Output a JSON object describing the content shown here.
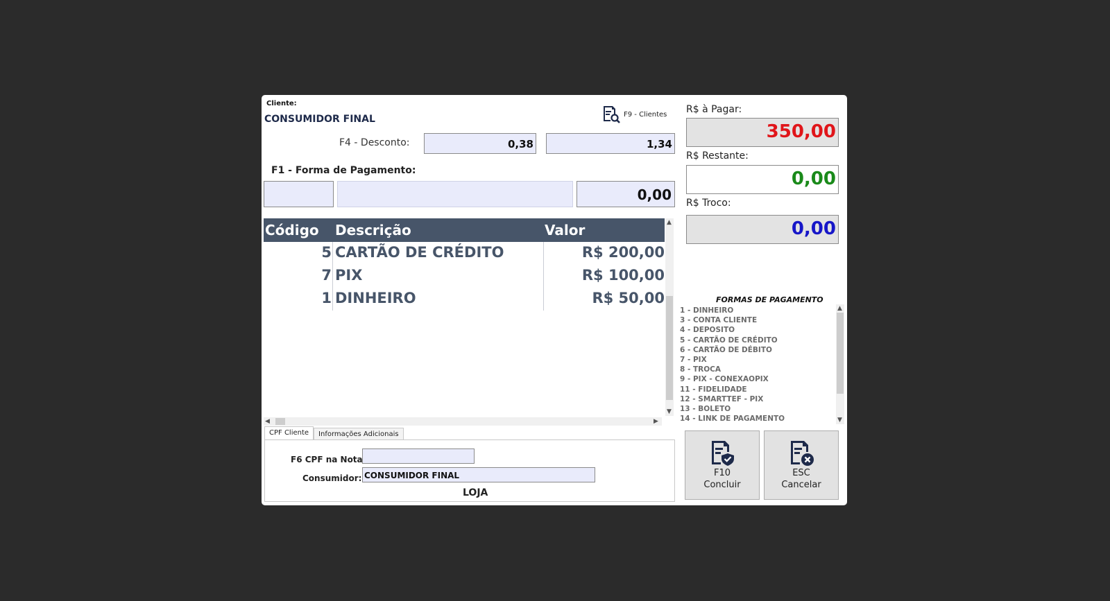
{
  "cliente": {
    "label": "Cliente:",
    "name": "CONSUMIDOR FINAL"
  },
  "f9_button": {
    "icon": "client-search-icon",
    "label": "F9 - Clientes"
  },
  "desconto": {
    "label": "F4 - Desconto:",
    "value1": "0,38",
    "value2": "1,34"
  },
  "forma_pagamento": {
    "label": "F1 - Forma de Pagamento:",
    "code": "",
    "description": "",
    "value": "0,00"
  },
  "grid": {
    "headers": {
      "code": "Código",
      "description": "Descrição",
      "value": "Valor"
    },
    "rows": [
      {
        "code": "5",
        "description": "CARTÃO DE CRÉDITO",
        "value": "R$ 200,00"
      },
      {
        "code": "7",
        "description": "PIX",
        "value": "R$ 100,00"
      },
      {
        "code": "1",
        "description": "DINHEIRO",
        "value": "R$ 50,00"
      }
    ]
  },
  "tabs": [
    {
      "label": "CPF Cliente",
      "active": true
    },
    {
      "label": "Informações Adicionais",
      "active": false
    }
  ],
  "cpf_panel": {
    "cpf_label": "F6 CPF na Nota:",
    "cpf_value": "",
    "consumidor_label": "Consumidor:",
    "consumidor_value": "CONSUMIDOR FINAL",
    "loja": "LOJA"
  },
  "totals": {
    "pagar_label": "R$ à Pagar:",
    "pagar_value": "350,00",
    "pagar_color": "#e0151a",
    "restante_label": "R$ Restante:",
    "restante_value": "0,00",
    "restante_color": "#1a8a1a",
    "troco_label": "R$ Troco:",
    "troco_value": "0,00",
    "troco_color": "#1616c8"
  },
  "formas": {
    "title": "FORMAS DE PAGAMENTO",
    "items": [
      "1 - DINHEIRO",
      "3 - CONTA CLIENTE",
      "4 - DEPOSITO",
      "5 - CARTÃO DE CRÉDITO",
      "6 - CARTÃO DE DÉBITO",
      "7 - PIX",
      "8 - TROCA",
      "9 - PIX - CONEXAOPIX",
      "11 - FIDELIDADE",
      "12 - SMARTTEF - PIX",
      "13 - BOLETO",
      "14 - LINK DE PAGAMENTO"
    ]
  },
  "actions": {
    "concluir": {
      "key": "F10",
      "label": "Concluir",
      "icon": "document-check-icon"
    },
    "cancelar": {
      "key": "ESC",
      "label": "Cancelar",
      "icon": "document-cancel-icon"
    }
  },
  "colors": {
    "header_bg": "#475569",
    "field_bg": "#e9ebfb",
    "page_bg": "#2b2b2b"
  }
}
